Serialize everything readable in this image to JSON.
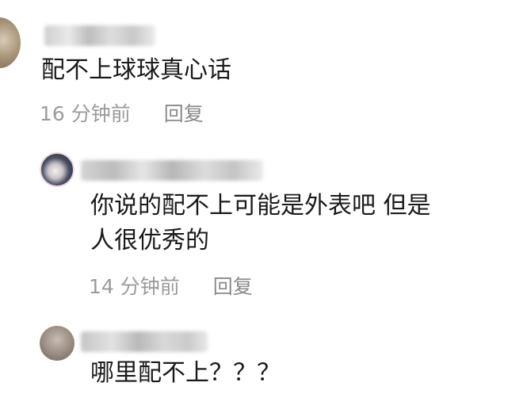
{
  "comments": [
    {
      "text": "配不上球球真心话",
      "time": "16 分钟前",
      "reply_label": "回复"
    },
    {
      "text_line1": "你说的配不上可能是外表吧 但是",
      "text_line2": "人很优秀的",
      "time": "14 分钟前",
      "reply_label": "回复"
    },
    {
      "text": "哪里配不上？？？"
    }
  ],
  "colors": {
    "body_text": "#1a1a1a",
    "meta_text": "#9b9b9b",
    "background": "#ffffff"
  }
}
